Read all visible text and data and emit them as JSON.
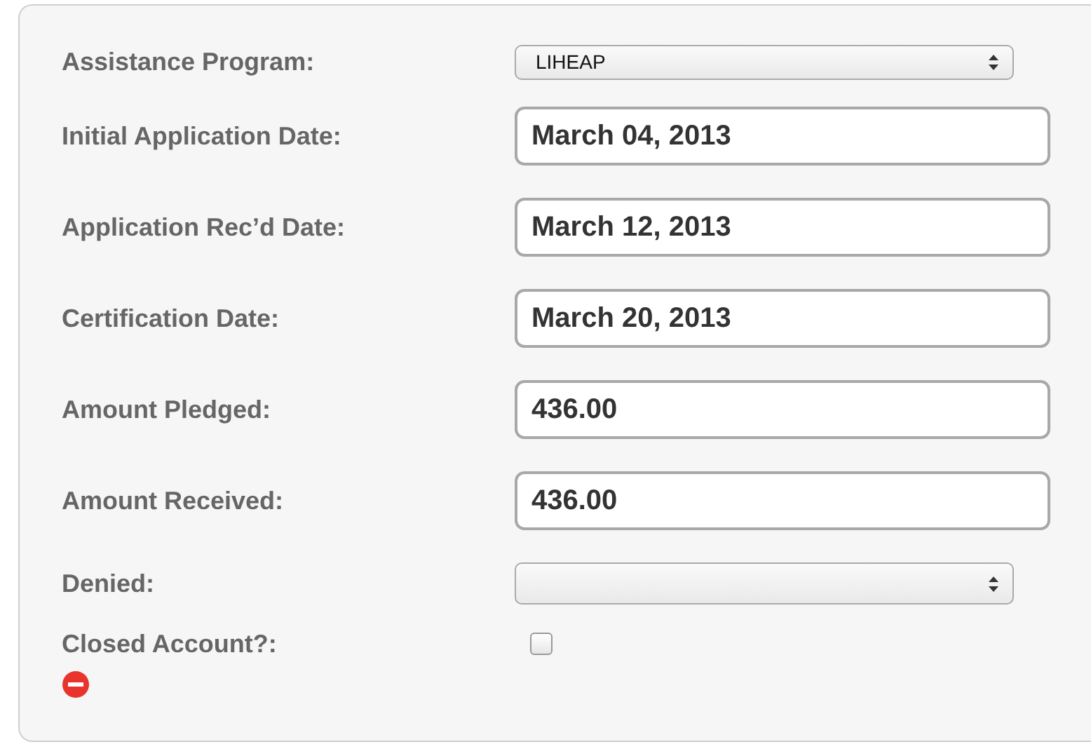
{
  "fields": [
    {
      "kind": "select",
      "label": "Assistance Program:",
      "value": "LIHEAP"
    },
    {
      "kind": "text",
      "label": "Initial Application Date:",
      "value": "March 04, 2013"
    },
    {
      "kind": "text",
      "label": "Application Rec’d Date:",
      "value": "March 12, 2013"
    },
    {
      "kind": "text",
      "label": "Certification Date:",
      "value": "March 20, 2013"
    },
    {
      "kind": "text",
      "label": "Amount Pledged:",
      "value": "436.00"
    },
    {
      "kind": "text",
      "label": "Amount Received:",
      "value": "436.00"
    },
    {
      "kind": "select",
      "label": "Denied:"
    },
    {
      "kind": "checkbox",
      "label": "Closed Account?:",
      "checked": false
    }
  ]
}
